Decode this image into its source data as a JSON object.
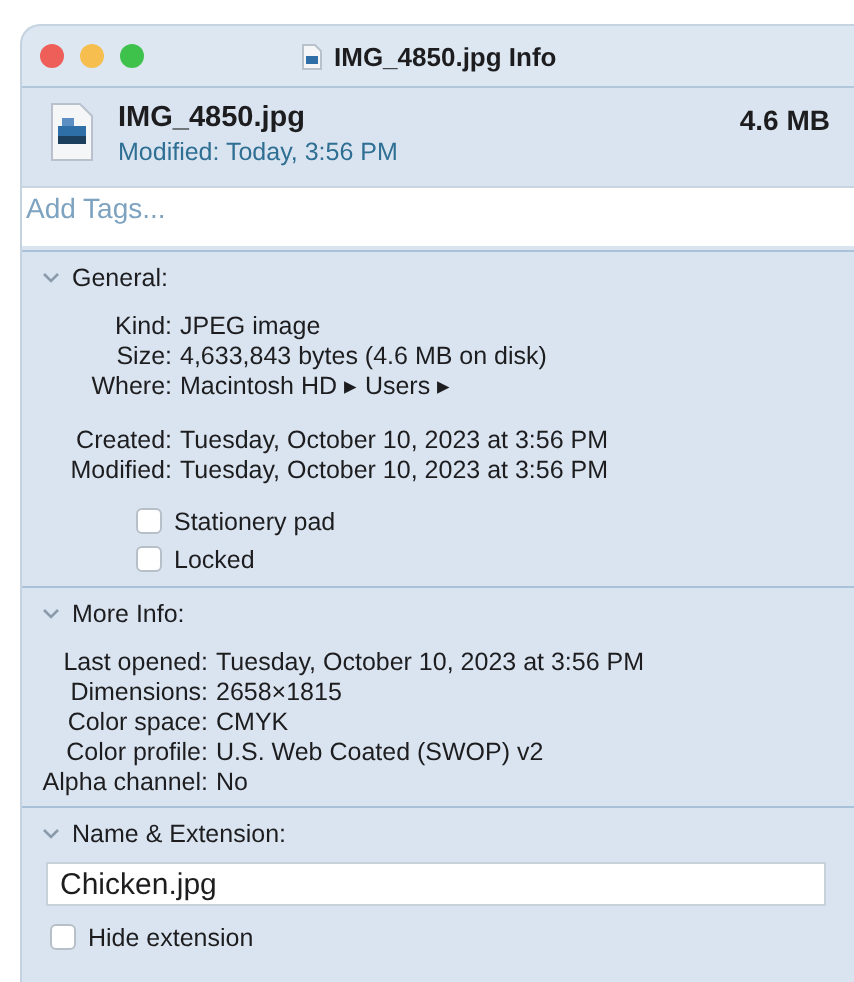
{
  "window": {
    "title": "IMG_4850.jpg Info"
  },
  "header": {
    "name": "IMG_4850.jpg",
    "modified": "Modified: Today, 3:56 PM",
    "size": "4.6 MB"
  },
  "tags": {
    "placeholder": "Add Tags..."
  },
  "sections": [
    {
      "title": "General:",
      "expanded": true,
      "groups": [
        [
          {
            "label": "Kind:",
            "value": "JPEG image"
          },
          {
            "label": "Size:",
            "value": "4,633,843 bytes (4.6 MB on disk)"
          },
          {
            "label": "Where:",
            "value": "Macintosh HD ▸ Users ▸"
          }
        ],
        [
          {
            "label": "Created:",
            "value": "Tuesday, October 10, 2023 at 3:56 PM"
          },
          {
            "label": "Modified:",
            "value": "Tuesday, October 10, 2023 at 3:56 PM"
          }
        ]
      ],
      "checkboxes": [
        {
          "label": "Stationery pad",
          "checked": false
        },
        {
          "label": "Locked",
          "checked": false
        }
      ]
    },
    {
      "title": "More Info:",
      "expanded": true,
      "groups": [
        [
          {
            "label": "Last opened:",
            "value": "Tuesday, October 10, 2023 at 3:56 PM"
          },
          {
            "label": "Dimensions:",
            "value": "2658×1815"
          },
          {
            "label": "Color space:",
            "value": "CMYK"
          },
          {
            "label": "Color profile:",
            "value": "U.S. Web Coated (SWOP) v2"
          },
          {
            "label": "Alpha channel:",
            "value": "No"
          }
        ]
      ]
    },
    {
      "title": "Name & Extension:",
      "expanded": true,
      "field": "Chicken.jpg",
      "checkboxes": [
        {
          "label": "Hide extension",
          "checked": false
        }
      ]
    }
  ]
}
